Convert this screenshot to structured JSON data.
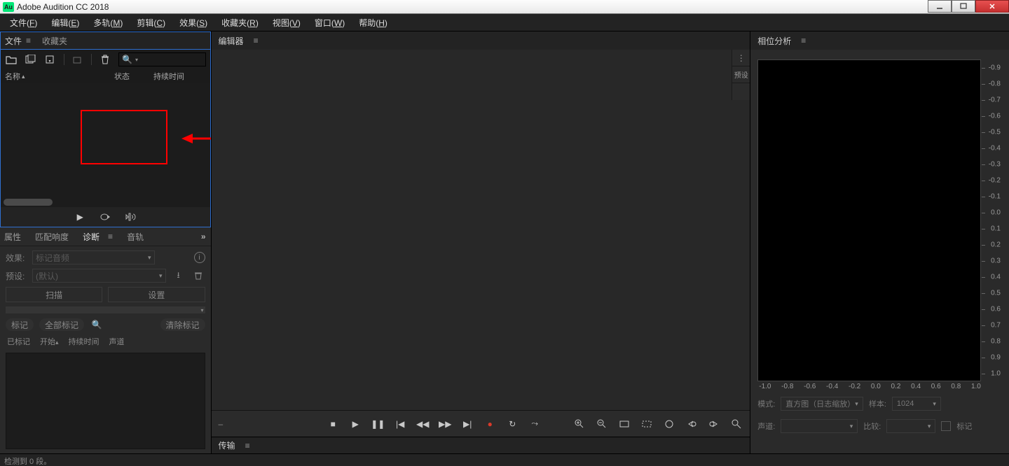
{
  "app": {
    "icon_text": "Au",
    "title": "Adobe Audition CC 2018"
  },
  "menus": [
    {
      "label": "文件",
      "key": "F"
    },
    {
      "label": "编辑",
      "key": "E"
    },
    {
      "label": "多轨",
      "key": "M"
    },
    {
      "label": "剪辑",
      "key": "C"
    },
    {
      "label": "效果",
      "key": "S"
    },
    {
      "label": "收藏夹",
      "key": "R"
    },
    {
      "label": "视图",
      "key": "V"
    },
    {
      "label": "窗口",
      "key": "W"
    },
    {
      "label": "帮助",
      "key": "H"
    }
  ],
  "files_panel": {
    "tabs": {
      "files": "文件",
      "favorites": "收藏夹"
    },
    "columns": {
      "name": "名称",
      "status": "状态",
      "duration": "持续时间"
    },
    "search_icon": "search-icon"
  },
  "editor": {
    "title": "编辑器",
    "preset_label": "预设"
  },
  "diag": {
    "tabs": {
      "properties": "属性",
      "loudness": "匹配响度",
      "diagnose": "诊断",
      "tone": "音轨"
    },
    "effect_label": "效果:",
    "effect_value": "标记音频",
    "preset_label": "预设:",
    "preset_value": "(默认)",
    "scan": "扫描",
    "settings": "设置",
    "mark": "标记",
    "mark_all": "全部标记",
    "clear_marks": "清除标记",
    "cols": {
      "marked": "已标记",
      "start": "开始",
      "dur": "持续时间",
      "channel": "声道"
    }
  },
  "transfer": {
    "title": "传输"
  },
  "phase": {
    "title": "相位分析",
    "y_ticks": [
      "-0.9",
      "-0.8",
      "-0.7",
      "-0.6",
      "-0.5",
      "-0.4",
      "-0.3",
      "-0.2",
      "-0.1",
      "0.0",
      "0.1",
      "0.2",
      "0.3",
      "0.4",
      "0.5",
      "0.6",
      "0.7",
      "0.8",
      "0.9",
      "1.0"
    ],
    "x_ticks": [
      "-1.0",
      "-0.8",
      "-0.6",
      "-0.4",
      "-0.2",
      "0.0",
      "0.2",
      "0.4",
      "0.6",
      "0.8",
      "1.0"
    ],
    "mode_label": "模式:",
    "mode_value": "直方图（日志缩放）",
    "samples_label": "样本:",
    "samples_value": "1024",
    "channel_label": "声道:",
    "compare_label": "比较:",
    "marker_label": "标记"
  },
  "status": {
    "text": "检测到 0 段。"
  }
}
